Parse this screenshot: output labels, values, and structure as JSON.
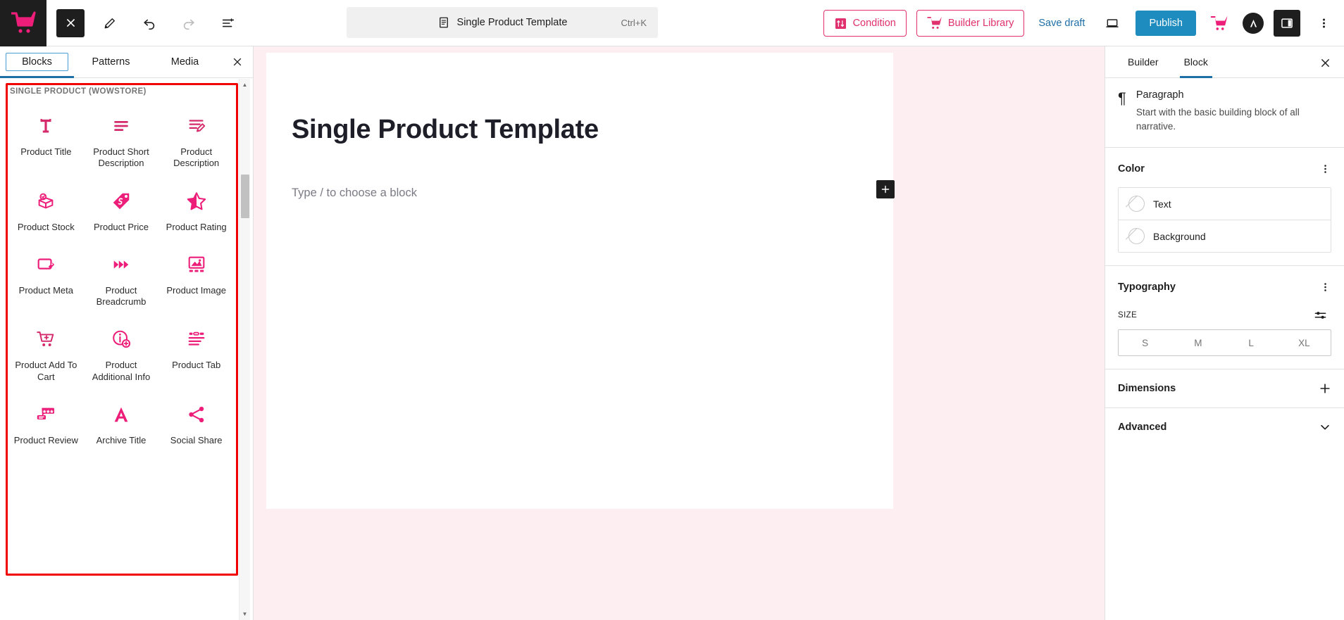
{
  "topbar": {
    "logo_icon": "wowstore-cart-logo-icon",
    "close_label": "close-inserter",
    "tools": [
      {
        "name": "toggle-block-inserter",
        "icon": "close-x-icon",
        "state": "active"
      },
      {
        "name": "tools-edit",
        "icon": "pencil-icon",
        "state": "default"
      },
      {
        "name": "undo",
        "icon": "undo-arrow-icon",
        "state": "default"
      },
      {
        "name": "redo",
        "icon": "redo-arrow-icon",
        "state": "disabled"
      },
      {
        "name": "list-view",
        "icon": "list-view-icon",
        "state": "default"
      }
    ],
    "document": {
      "icon": "document-page-icon",
      "title": "Single Product Template",
      "shortcut": "Ctrl+K"
    },
    "condition_label": "Condition",
    "condition_icon": "condition-filter-icon",
    "builder_library_label": "Builder Library",
    "builder_library_icon": "wowstore-cart-icon",
    "save_draft_label": "Save draft",
    "preview_icon": "desktop-preview-icon",
    "publish_label": "Publish",
    "wow_icon": "wowstore-cart-icon",
    "astra_icon": "astra-logo-icon",
    "settings_panel_icon": "sidebar-toggle-icon",
    "options_icon": "kebab-menu-icon"
  },
  "inserter": {
    "tabs": [
      {
        "label": "Blocks",
        "active": true
      },
      {
        "label": "Patterns",
        "active": false
      },
      {
        "label": "Media",
        "active": false
      }
    ],
    "close_icon": "close-x-icon",
    "category": "SINGLE PRODUCT (WOWSTORE)",
    "highlight_color": "#f00000",
    "accent_color": "#e0306e",
    "blocks": [
      {
        "label": "Product Title",
        "icon": "text-title-t-icon"
      },
      {
        "label": "Product Short Description",
        "icon": "short-text-lines-icon"
      },
      {
        "label": "Product Description",
        "icon": "text-lines-pencil-icon"
      },
      {
        "label": "Product Stock",
        "icon": "box-check-icon"
      },
      {
        "label": "Product Price",
        "icon": "price-tag-icon"
      },
      {
        "label": "Product Rating",
        "icon": "half-star-icon"
      },
      {
        "label": "Product Meta",
        "icon": "frame-tag-icon"
      },
      {
        "label": "Product Breadcrumb",
        "icon": "triple-chevron-icon"
      },
      {
        "label": "Product Image",
        "icon": "image-gallery-icon"
      },
      {
        "label": "Product Add To Cart",
        "icon": "cart-plus-icon"
      },
      {
        "label": "Product Additional Info",
        "icon": "info-plus-icon"
      },
      {
        "label": "Product Tab",
        "icon": "tab-lines-icon"
      },
      {
        "label": "Product Review",
        "icon": "review-stars-bubble-icon"
      },
      {
        "label": "Archive Title",
        "icon": "letter-a-icon"
      },
      {
        "label": "Social Share",
        "icon": "share-nodes-icon"
      }
    ],
    "scrollbar": {
      "up_icon": "scroll-up-arrow",
      "down_icon": "scroll-down-arrow"
    }
  },
  "canvas": {
    "background_color": "#fdeef2",
    "post_title": "Single Product Template",
    "paragraph_placeholder": "Type / to choose a block",
    "add_block_label": "+"
  },
  "sidebar": {
    "tabs": [
      {
        "label": "Builder",
        "active": false
      },
      {
        "label": "Block",
        "active": true
      }
    ],
    "close_icon": "close-x-icon",
    "block": {
      "icon": "paragraph-pilcrow-icon",
      "glyph": "¶",
      "name": "Paragraph",
      "description": "Start with the basic building block of all narrative."
    },
    "color": {
      "title": "Color",
      "options_icon": "kebab-menu-icon",
      "rows": [
        {
          "label": "Text",
          "swatch": "none"
        },
        {
          "label": "Background",
          "swatch": "none"
        }
      ]
    },
    "typography": {
      "title": "Typography",
      "options_icon": "kebab-menu-icon",
      "size_label": "SIZE",
      "size_settings_icon": "sliders-icon",
      "sizes": [
        "S",
        "M",
        "L",
        "XL"
      ],
      "selected_size": null
    },
    "sections": [
      {
        "title": "Dimensions",
        "icon": "plus-icon"
      },
      {
        "title": "Advanced",
        "icon": "chevron-down-icon"
      }
    ]
  }
}
